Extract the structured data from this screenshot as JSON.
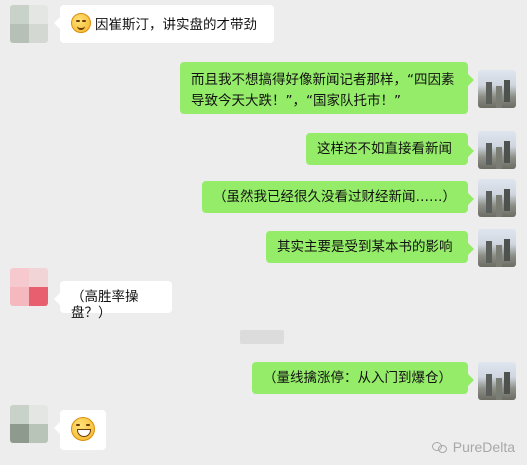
{
  "messages": [
    {
      "side": "left",
      "text": "因崔斯汀，讲实盘的才带劲",
      "emoji_prefix": "grin-emoji"
    },
    {
      "side": "right",
      "text": "而且我不想搞得好像新闻记者那样，“四因素导致今天大跌！”，“国家队托市！”"
    },
    {
      "side": "right",
      "text": "这样还不如直接看新闻"
    },
    {
      "side": "right",
      "text": "（虽然我已经很久没看过财经新闻……）"
    },
    {
      "side": "right",
      "text": "其实主要是受到某本书的影响"
    },
    {
      "side": "left",
      "text": "（高胜率操盘？）"
    },
    {
      "side": "right",
      "text": "（量线擒涨停：从入门到爆仓）"
    },
    {
      "side": "left",
      "text": "",
      "emoji_only": "grimace-emoji"
    }
  ],
  "watermark": {
    "text": "PureDelta",
    "icon": "wechat-icon"
  },
  "colors": {
    "background": "#ededed",
    "right_bubble": "#95ec69",
    "left_bubble": "#ffffff"
  }
}
